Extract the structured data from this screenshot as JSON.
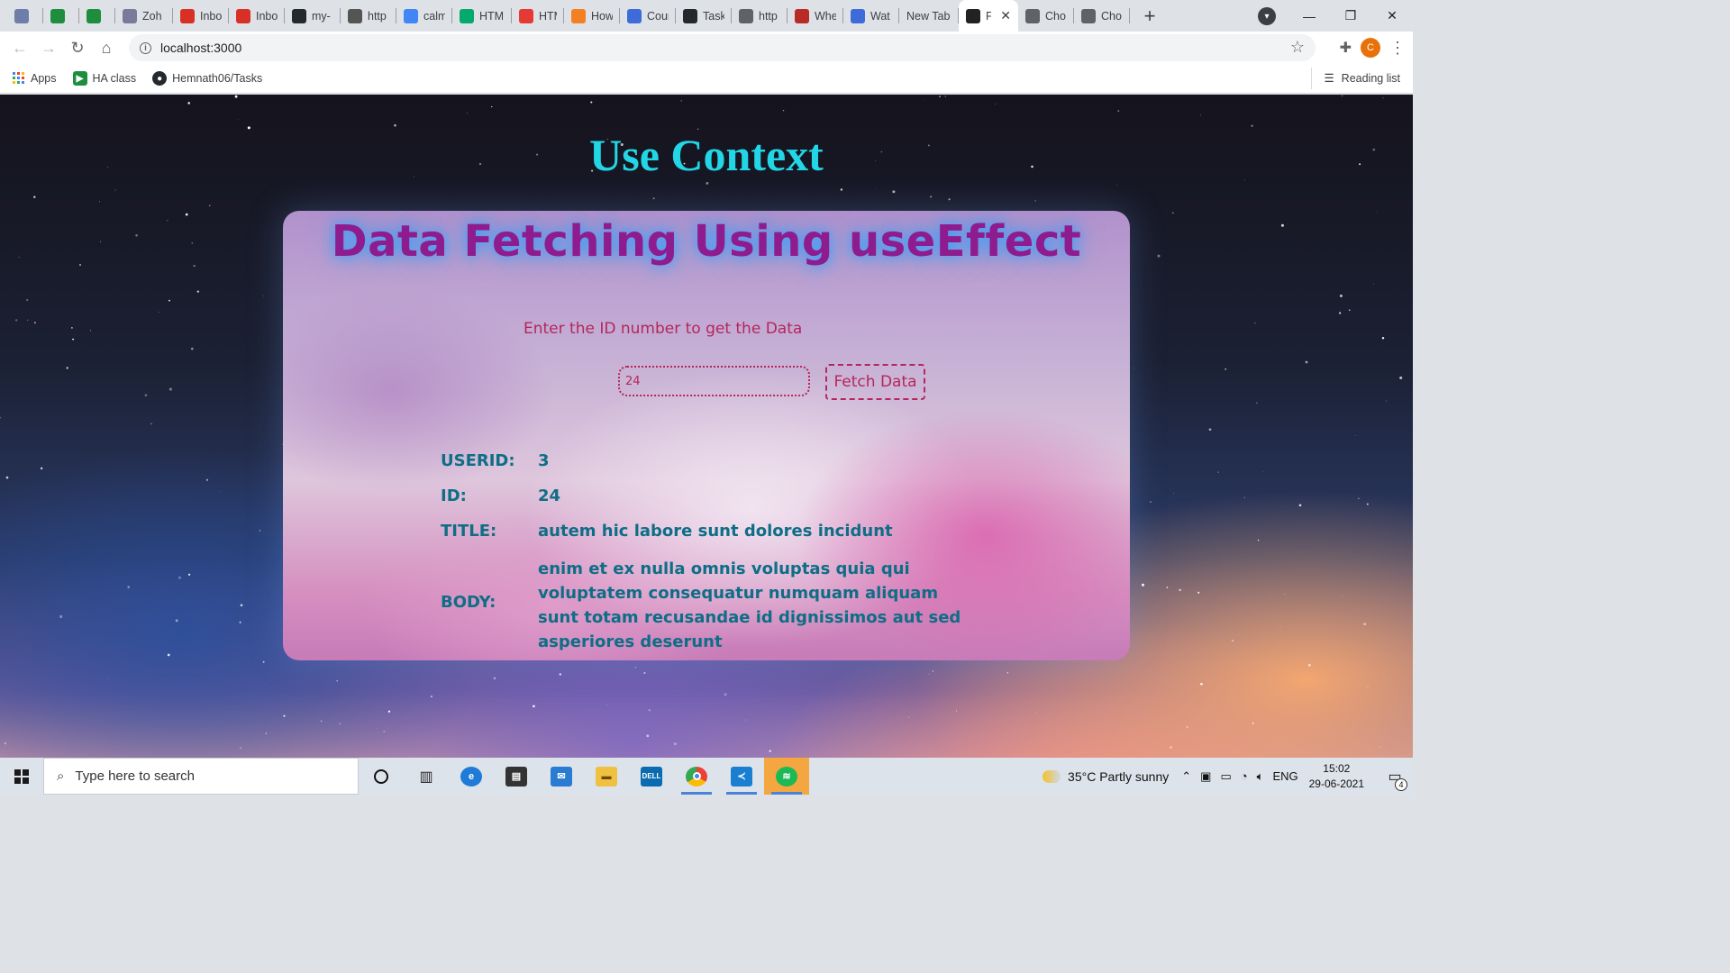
{
  "browser": {
    "tabs": [
      {
        "label": "",
        "favicon": "react-icon",
        "color": "#6d7ea8"
      },
      {
        "label": "",
        "favicon": "meet-icon",
        "color": "#1e8e3e"
      },
      {
        "label": "",
        "favicon": "meet-icon",
        "color": "#1e8e3e"
      },
      {
        "label": "Zoh",
        "favicon": "zoho-icon",
        "color": "#7a7a9a"
      },
      {
        "label": "Inbo",
        "favicon": "gmail-icon",
        "color": "#d93025"
      },
      {
        "label": "Inbo",
        "favicon": "gmail-icon",
        "color": "#d93025"
      },
      {
        "label": "my-",
        "favicon": "github-icon",
        "color": "#24292e"
      },
      {
        "label": "http",
        "favicon": "tab-icon",
        "color": "#555555"
      },
      {
        "label": "calm",
        "favicon": "google-icon",
        "color": "#4285f4"
      },
      {
        "label": "HTM",
        "favicon": "w3schools-icon",
        "color": "#04aa6d"
      },
      {
        "label": "HTM",
        "favicon": "red-circle-icon",
        "color": "#e53935"
      },
      {
        "label": "How",
        "favicon": "stackoverflow-icon",
        "color": "#f48024"
      },
      {
        "label": "Cour",
        "favicon": "course-icon",
        "color": "#3d6bd9"
      },
      {
        "label": "Task",
        "favicon": "github-icon",
        "color": "#24292e"
      },
      {
        "label": "http",
        "favicon": "globe-icon",
        "color": "#5f6368"
      },
      {
        "label": "Whe",
        "favicon": "quora-icon",
        "color": "#b92b27"
      },
      {
        "label": "Wat",
        "favicon": "play-icon",
        "color": "#3d6bd9"
      },
      {
        "label": "New Tab",
        "favicon": "",
        "color": ""
      },
      {
        "label": "F",
        "favicon": "react-icon",
        "color": "#222222",
        "active": true
      },
      {
        "label": "Cho",
        "favicon": "globe-icon",
        "color": "#5f6368"
      },
      {
        "label": "Cho",
        "favicon": "globe-icon",
        "color": "#5f6368"
      }
    ],
    "url": "localhost:3000",
    "profile_initial": "C",
    "bookmarks": [
      {
        "label": "Apps",
        "icon": "apps-grid-icon"
      },
      {
        "label": "HA class",
        "icon": "meet-icon"
      },
      {
        "label": "Hemnath06/Tasks",
        "icon": "github-icon"
      }
    ],
    "reading_list": "Reading list"
  },
  "page": {
    "title": "Use Context",
    "card_title": "Data Fetching Using useEffect",
    "prompt": "Enter the ID number to get the Data",
    "input_value": "24",
    "button_label": "Fetch Data",
    "result": {
      "userid_label": "USERID:",
      "userid_value": "3",
      "id_label": "ID:",
      "id_value": "24",
      "title_label": "TITLE:",
      "title_value": "autem hic labore sunt dolores incidunt",
      "body_label": "BODY:",
      "body_value": "enim et ex nulla omnis voluptas quia qui voluptatem consequatur numquam aliquam sunt totam recusandae id dignissimos aut sed asperiores deserunt"
    }
  },
  "taskbar": {
    "search_placeholder": "Type here to search",
    "weather": "35°C  Partly sunny",
    "language": "ENG",
    "time": "15:02",
    "date": "29-06-2021",
    "notifications": "4"
  }
}
